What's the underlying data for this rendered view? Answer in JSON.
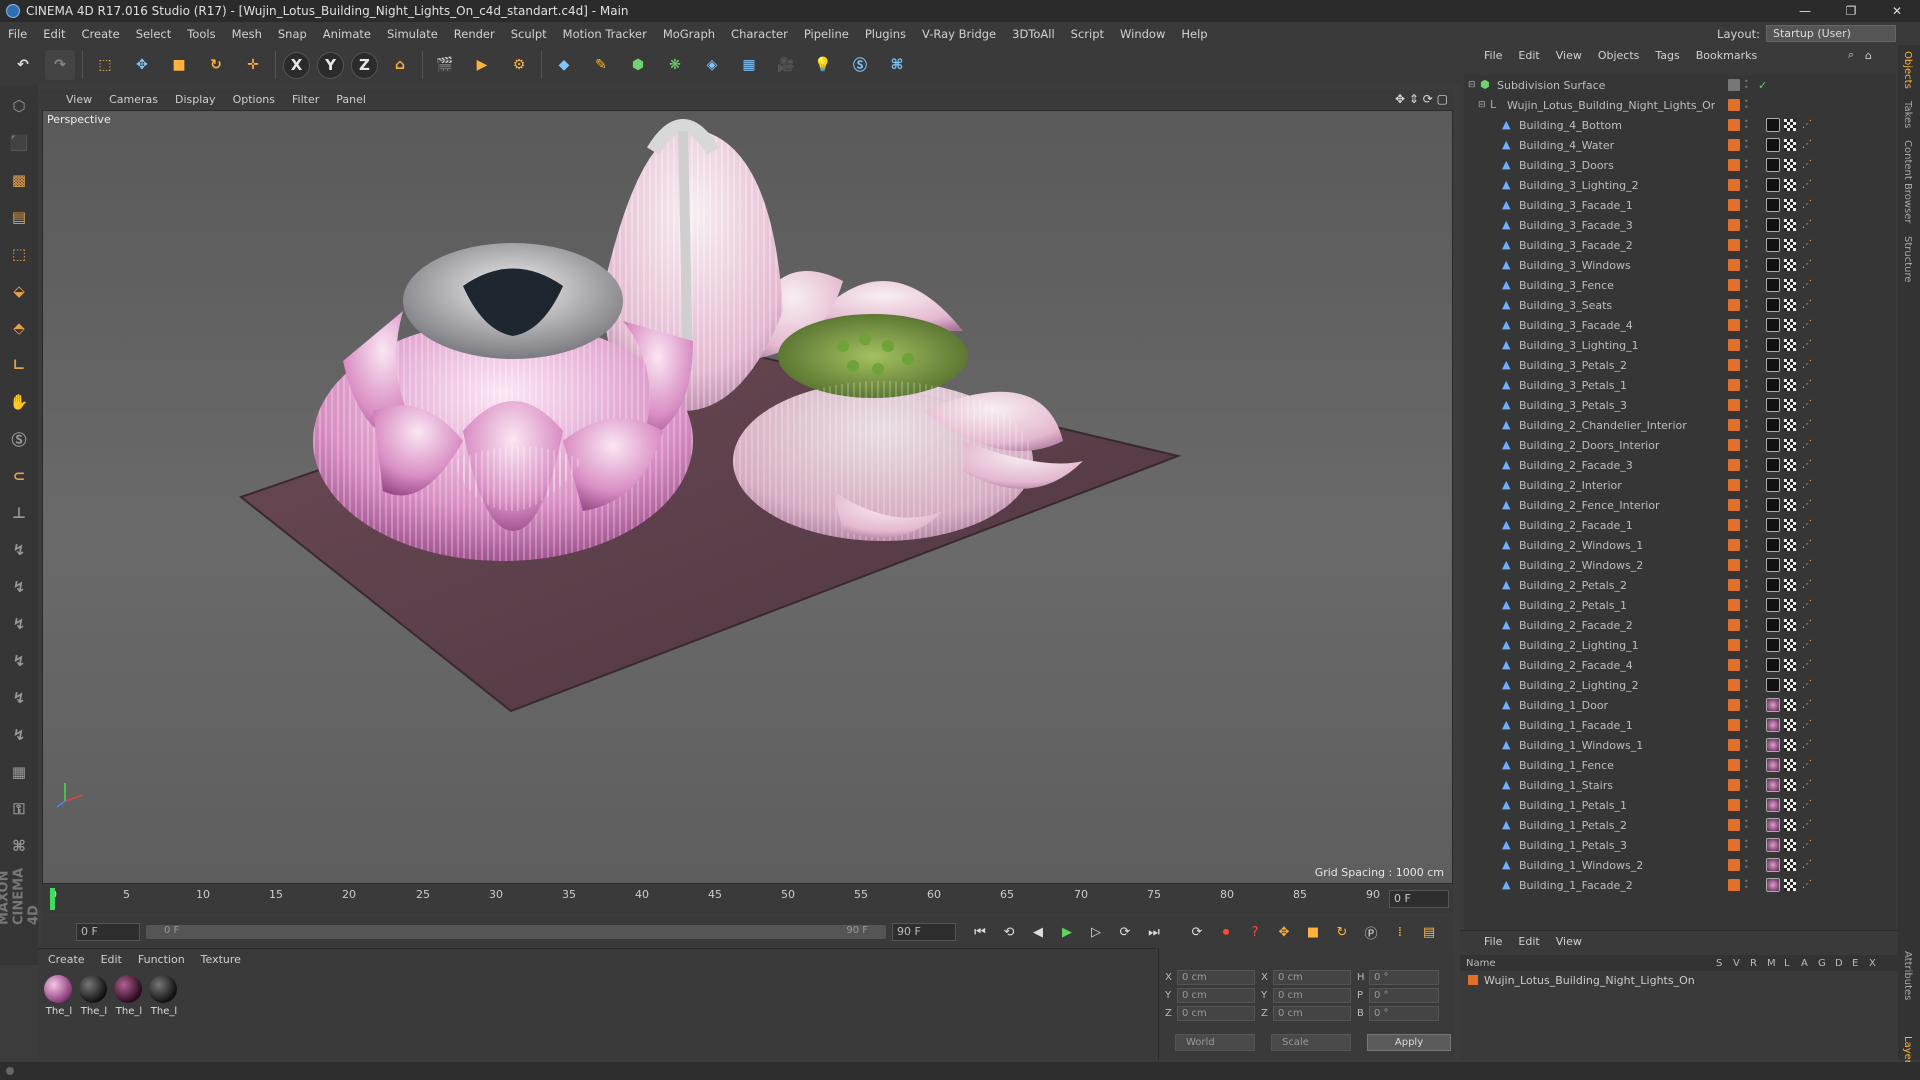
{
  "title": "CINEMA 4D R17.016 Studio (R17) - [Wujin_Lotus_Building_Night_Lights_On_c4d_standart.c4d] - Main",
  "window_controls": [
    "—",
    "❐",
    "✕"
  ],
  "menu": [
    "File",
    "Edit",
    "Create",
    "Select",
    "Tools",
    "Mesh",
    "Snap",
    "Animate",
    "Simulate",
    "Render",
    "Sculpt",
    "Motion Tracker",
    "MoGraph",
    "Character",
    "Pipeline",
    "Plugins",
    "V-Ray Bridge",
    "3DToAll",
    "Script",
    "Window",
    "Help"
  ],
  "layout": {
    "label": "Layout:",
    "value": "Startup (User)"
  },
  "viewport": {
    "menu": [
      "View",
      "Cameras",
      "Display",
      "Options",
      "Filter",
      "Panel"
    ],
    "label": "Perspective",
    "grid_spacing": "Grid Spacing : 1000 cm"
  },
  "timeline": {
    "ticks": [
      "0",
      "5",
      "10",
      "15",
      "20",
      "25",
      "30",
      "35",
      "40",
      "45",
      "50",
      "55",
      "60",
      "65",
      "70",
      "75",
      "80",
      "85",
      "90"
    ],
    "current_frame": "0 F"
  },
  "playbar": {
    "start": "0 F",
    "range_start": "0 F",
    "range_end": "90 F",
    "end": "90 F"
  },
  "material_menu": [
    "Create",
    "Edit",
    "Function",
    "Texture"
  ],
  "materials": [
    {
      "name": "The_l",
      "style": "pink"
    },
    {
      "name": "The_l",
      "style": "dark"
    },
    {
      "name": "The_l",
      "style": "dark2"
    },
    {
      "name": "The_l",
      "style": "dark"
    }
  ],
  "coords": {
    "rows": [
      {
        "a": "X",
        "v1": "0 cm",
        "b": "X",
        "v2": "0 cm",
        "c": "H",
        "v3": "0 °"
      },
      {
        "a": "Y",
        "v1": "0 cm",
        "b": "Y",
        "v2": "0 cm",
        "c": "P",
        "v3": "0 °"
      },
      {
        "a": "Z",
        "v1": "0 cm",
        "b": "Z",
        "v2": "0 cm",
        "c": "B",
        "v3": "0 °"
      }
    ],
    "mode": "World",
    "type": "Scale",
    "apply": "Apply"
  },
  "objects_menu": [
    "File",
    "Edit",
    "View",
    "Objects",
    "Tags",
    "Bookmarks"
  ],
  "objects": [
    {
      "name": "Subdivision Surface",
      "level": 0,
      "tag": "none"
    },
    {
      "name": "Wujin_Lotus_Building_Night_Lights_On",
      "level": 1,
      "tag": "null"
    },
    {
      "name": "Building_4_Bottom",
      "level": 2,
      "tag": "dark"
    },
    {
      "name": "Building_4_Water",
      "level": 2,
      "tag": "dark"
    },
    {
      "name": "Building_3_Doors",
      "level": 2,
      "tag": "dark"
    },
    {
      "name": "Building_3_Lighting_2",
      "level": 2,
      "tag": "dark"
    },
    {
      "name": "Building_3_Facade_1",
      "level": 2,
      "tag": "dark"
    },
    {
      "name": "Building_3_Facade_3",
      "level": 2,
      "tag": "dark"
    },
    {
      "name": "Building_3_Facade_2",
      "level": 2,
      "tag": "dark"
    },
    {
      "name": "Building_3_Windows",
      "level": 2,
      "tag": "dark"
    },
    {
      "name": "Building_3_Fence",
      "level": 2,
      "tag": "dark"
    },
    {
      "name": "Building_3_Seats",
      "level": 2,
      "tag": "dark"
    },
    {
      "name": "Building_3_Facade_4",
      "level": 2,
      "tag": "dark"
    },
    {
      "name": "Building_3_Lighting_1",
      "level": 2,
      "tag": "dark"
    },
    {
      "name": "Building_3_Petals_2",
      "level": 2,
      "tag": "dark"
    },
    {
      "name": "Building_3_Petals_1",
      "level": 2,
      "tag": "dark"
    },
    {
      "name": "Building_3_Petals_3",
      "level": 2,
      "tag": "dark"
    },
    {
      "name": "Building_2_Chandelier_Interior",
      "level": 2,
      "tag": "dark"
    },
    {
      "name": "Building_2_Doors_Interior",
      "level": 2,
      "tag": "dark"
    },
    {
      "name": "Building_2_Facade_3",
      "level": 2,
      "tag": "dark"
    },
    {
      "name": "Building_2_Interior",
      "level": 2,
      "tag": "dark"
    },
    {
      "name": "Building_2_Fence_Interior",
      "level": 2,
      "tag": "dark"
    },
    {
      "name": "Building_2_Facade_1",
      "level": 2,
      "tag": "dark"
    },
    {
      "name": "Building_2_Windows_1",
      "level": 2,
      "tag": "dark"
    },
    {
      "name": "Building_2_Windows_2",
      "level": 2,
      "tag": "dark"
    },
    {
      "name": "Building_2_Petals_2",
      "level": 2,
      "tag": "dark"
    },
    {
      "name": "Building_2_Petals_1",
      "level": 2,
      "tag": "dark"
    },
    {
      "name": "Building_2_Facade_2",
      "level": 2,
      "tag": "dark"
    },
    {
      "name": "Building_2_Lighting_1",
      "level": 2,
      "tag": "dark"
    },
    {
      "name": "Building_2_Facade_4",
      "level": 2,
      "tag": "dark"
    },
    {
      "name": "Building_2_Lighting_2",
      "level": 2,
      "tag": "dark"
    },
    {
      "name": "Building_1_Door",
      "level": 2,
      "tag": "pink"
    },
    {
      "name": "Building_1_Facade_1",
      "level": 2,
      "tag": "pink"
    },
    {
      "name": "Building_1_Windows_1",
      "level": 2,
      "tag": "pink"
    },
    {
      "name": "Building_1_Fence",
      "level": 2,
      "tag": "pink"
    },
    {
      "name": "Building_1_Stairs",
      "level": 2,
      "tag": "pink"
    },
    {
      "name": "Building_1_Petals_1",
      "level": 2,
      "tag": "pink"
    },
    {
      "name": "Building_1_Petals_2",
      "level": 2,
      "tag": "pink"
    },
    {
      "name": "Building_1_Petals_3",
      "level": 2,
      "tag": "pink"
    },
    {
      "name": "Building_1_Windows_2",
      "level": 2,
      "tag": "pink"
    },
    {
      "name": "Building_1_Facade_2",
      "level": 2,
      "tag": "pink"
    }
  ],
  "layers_menu": [
    "File",
    "Edit",
    "View"
  ],
  "layers_header": {
    "name": "Name",
    "cols": [
      "S",
      "V",
      "R",
      "M",
      "L",
      "A",
      "G",
      "D",
      "E",
      "X"
    ]
  },
  "layers_row": "Wujin_Lotus_Building_Night_Lights_On",
  "side_tabs": [
    "Objects",
    "Takes",
    "Content Browser",
    "Structure"
  ],
  "side_tabs_bottom": [
    "Attributes",
    "Layers"
  ],
  "maxon_logo": "MAXON CINEMA 4D"
}
